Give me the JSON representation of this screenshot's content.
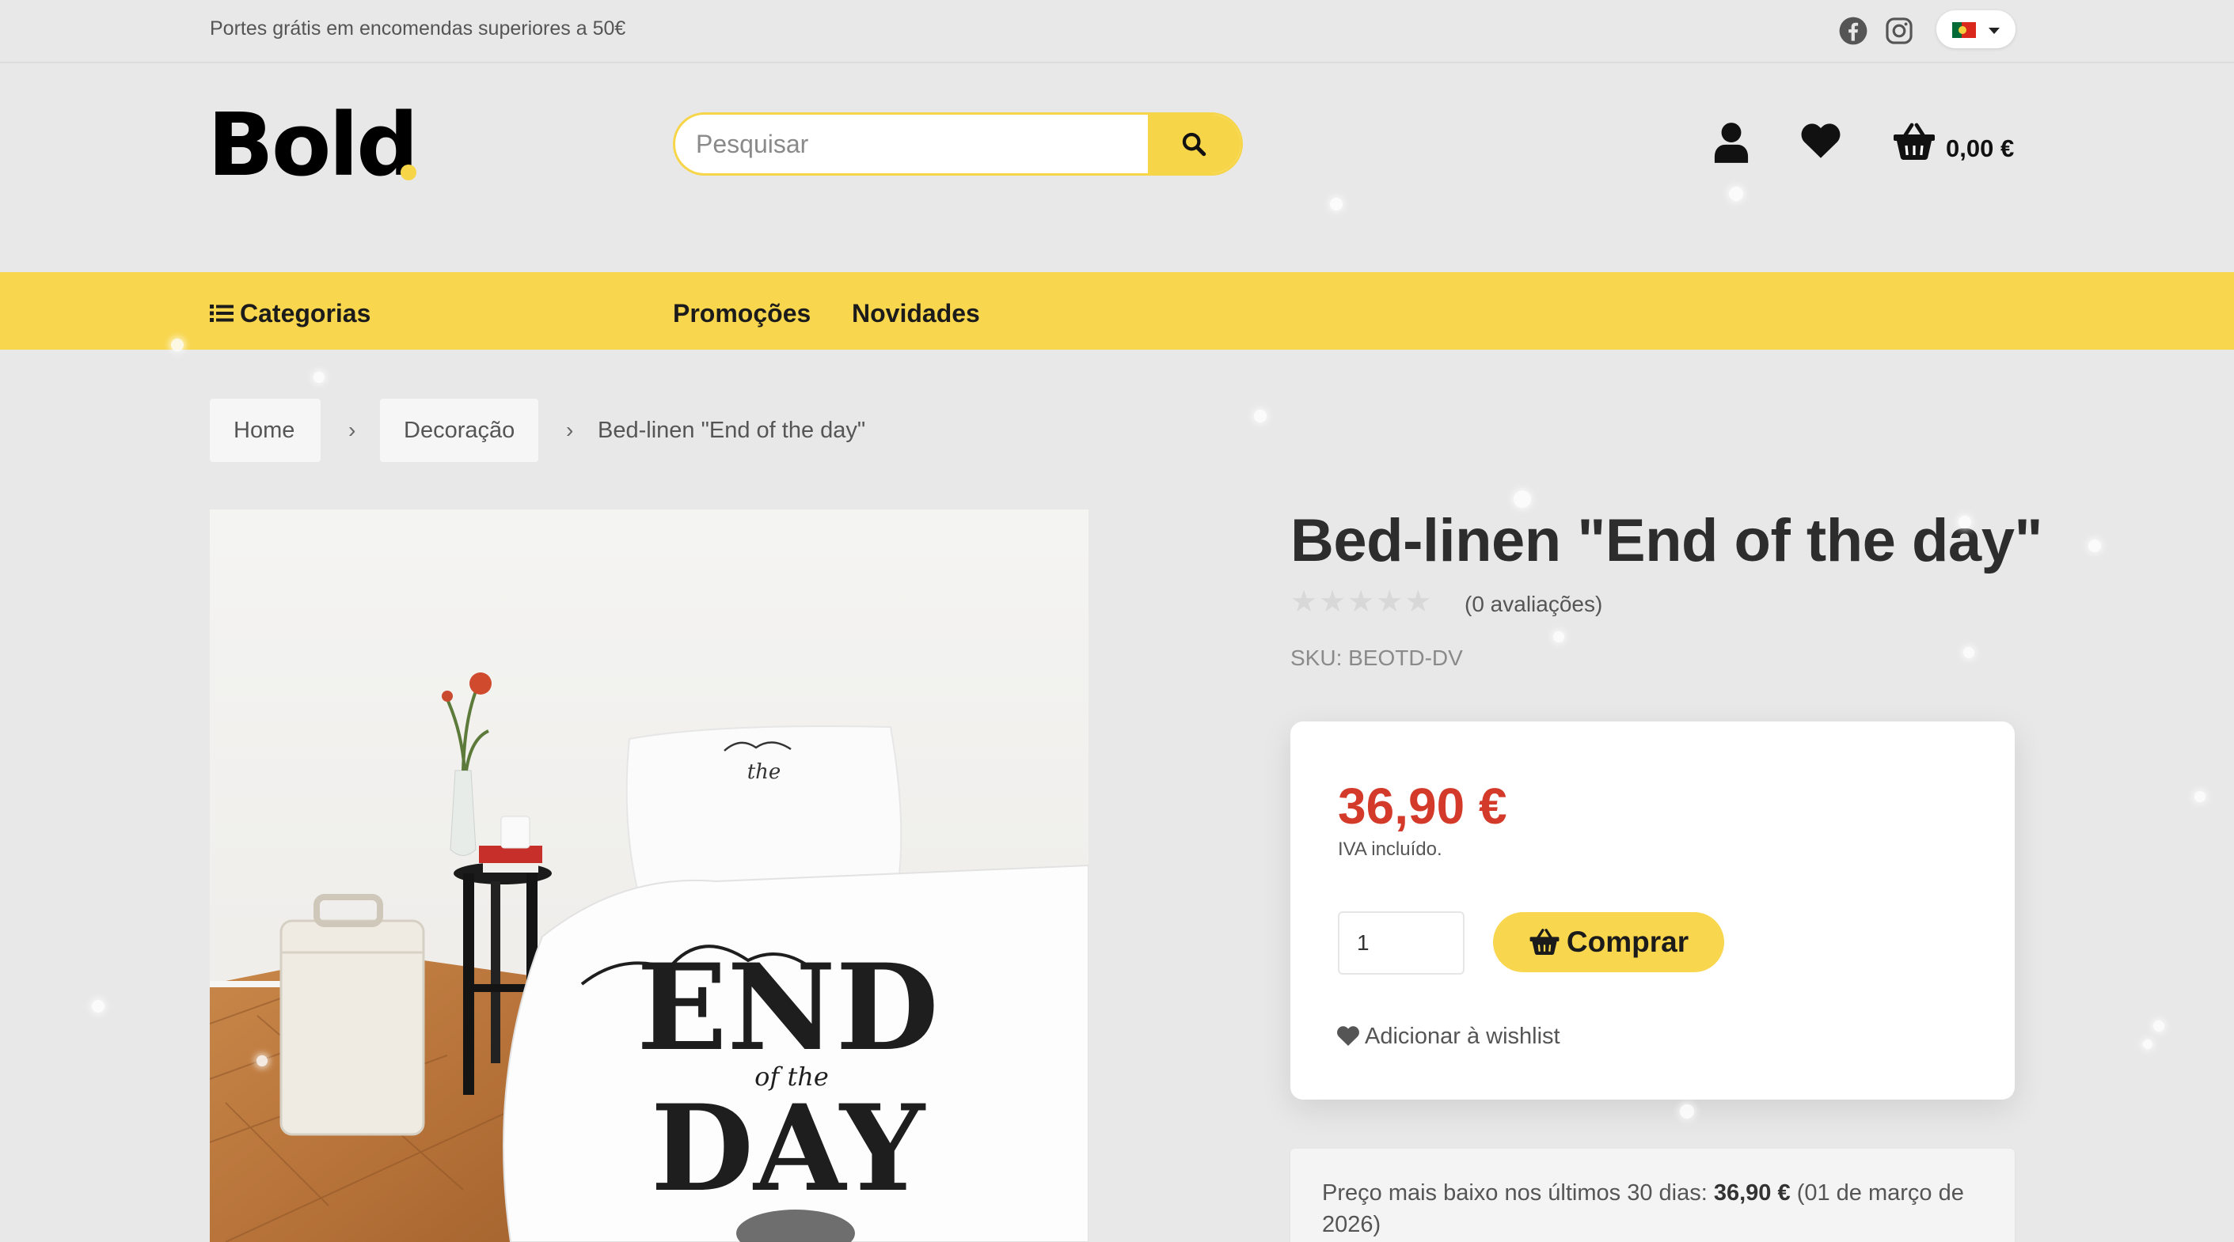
{
  "topbar": {
    "promo_text": "Portes grátis em encomendas superiores a 50€",
    "social": [
      "facebook-icon",
      "instagram-icon"
    ],
    "language": "pt"
  },
  "header": {
    "logo_text": "Bold",
    "search_placeholder": "Pesquisar",
    "cart_total": "0,00 €"
  },
  "nav": {
    "categories": "Categorias",
    "promotions": "Promoções",
    "news": "Novidades"
  },
  "breadcrumb": {
    "home": "Home",
    "category": "Decoração",
    "current": "Bed-linen \"End of the day\"",
    "separator": "›"
  },
  "product": {
    "title": "Bed-linen \"End of the day\"",
    "rating": 0,
    "reviews": "(0 avaliações)",
    "sku": "SKU: BEOTD-DV",
    "price": "36,90 €",
    "vat_note": "IVA incluído.",
    "quantity": "1",
    "buy_label": "Comprar",
    "wishlist_label": "Adicionar à wishlist",
    "lowest_price_label": "Preço mais baixo nos últimos 30 dias:",
    "lowest_price_value": "36,90 €",
    "lowest_price_date": "(01 de março de 2026)",
    "image_text": {
      "pillow": "the",
      "duvet_line1": "END",
      "duvet_line2": "of the",
      "duvet_line3": "DAY"
    }
  },
  "colors": {
    "accent": "#f8d64d",
    "price": "#d33a2a",
    "background": "#e8e8e8"
  }
}
